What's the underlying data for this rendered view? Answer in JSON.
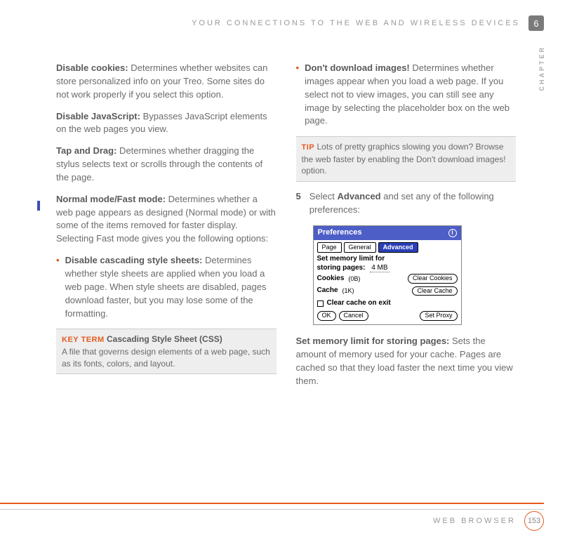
{
  "header": {
    "title": "YOUR CONNECTIONS TO THE WEB AND WIRELESS DEVICES",
    "chapter_number": "6",
    "chapter_label": "CHAPTER"
  },
  "left_column": {
    "p1": {
      "label": "Disable cookies:",
      "text": " Determines whether websites can store personalized info on your Treo. Some sites do not work properly if you select this option."
    },
    "p2": {
      "label": "Disable JavaScript:",
      "text": " Bypasses JavaScript elements on the web pages you view."
    },
    "p3": {
      "label": "Tap and Drag:",
      "text": " Determines whether dragging the stylus selects text or scrolls through the contents of the page."
    },
    "p4": {
      "label": "Normal mode/Fast mode:",
      "text": " Determines whether a web page appears as designed (Normal mode) or with some of the items removed for faster display. Selecting Fast mode gives you the following options:"
    },
    "b1": {
      "label": "Disable cascading style sheets:",
      "text": " Determines whether style sheets are applied when you load a web page. When style sheets are disabled, pages download faster, but you may lose some of the formatting."
    },
    "keyterm": {
      "tag": "KEY TERM",
      "title": "Cascading Style Sheet (CSS)",
      "body": "A file that governs design elements of a web page, such as its fonts, colors, and layout."
    }
  },
  "right_column": {
    "b1": {
      "label": "Don't download images!",
      "text": " Determines whether images appear when you load a web page. If you select not to view images, you can still see any image by selecting the placeholder box on the web page."
    },
    "tip": {
      "tag": "TIP",
      "body": "Lots of pretty graphics slowing you down? Browse the web faster by enabling the Don't download images! option."
    },
    "step5": {
      "num": "5",
      "pre": "Select ",
      "bold": "Advanced",
      "post": " and set any of the following preferences:"
    },
    "screenshot": {
      "title": "Preferences",
      "info_icon": "i",
      "tabs": {
        "page": "Page",
        "general": "General",
        "advanced": "Advanced"
      },
      "mem_line1": "Set memory limit for",
      "mem_line2": "storing pages:",
      "mem_value": "4 MB",
      "cookies": {
        "label": "Cookies",
        "size": "(0B)",
        "btn": "Clear Cookies"
      },
      "cache": {
        "label": "Cache",
        "size": "(1K)",
        "btn": "Clear Cache"
      },
      "clear_on_exit": "Clear cache on exit",
      "footer": {
        "ok": "OK",
        "cancel": "Cancel",
        "setproxy": "Set Proxy"
      }
    },
    "p_after": {
      "label": "Set memory limit for storing pages:",
      "text": " Sets the amount of memory used for your cache. Pages are cached so that they load faster the next time you view them."
    }
  },
  "footer": {
    "label": "WEB BROWSER",
    "page": "153"
  },
  "glyphs": {
    "bullet": "•"
  }
}
